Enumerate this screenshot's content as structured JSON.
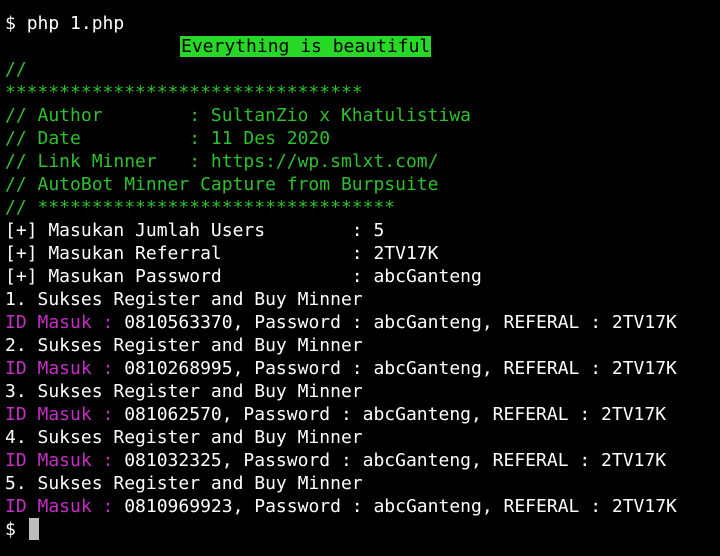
{
  "command_line": {
    "prompt": "$",
    "command": "php 1.php"
  },
  "banner": "Everything is beautiful",
  "header": {
    "comment": "//",
    "stars": "*********************************",
    "author": "// Author        : SultanZio x Khatulistiwa",
    "date": "// Date          : 11 Des 2020",
    "link": "// Link Minner   : https://wp.smlxt.com/",
    "desc": "// AutoBot Minner Capture from Burpsuite",
    "footer": "// *********************************"
  },
  "inputs": [
    {
      "text": "[+] Masukan Jumlah Users        : 5"
    },
    {
      "text": "[+] Masukan Referral            : 2TV17K"
    },
    {
      "text": "[+] Masukan Password            : abcGanteng"
    }
  ],
  "results": [
    {
      "status": "1. Sukses Register and Buy Minner",
      "label": "ID Masuk :",
      "detail": " 0810563370, Password : abcGanteng, REFERAL : 2TV17K"
    },
    {
      "status": "2. Sukses Register and Buy Minner",
      "label": "ID Masuk :",
      "detail": " 0810268995, Password : abcGanteng, REFERAL : 2TV17K"
    },
    {
      "status": "3. Sukses Register and Buy Minner",
      "label": "ID Masuk :",
      "detail": " 081062570, Password : abcGanteng, REFERAL : 2TV17K"
    },
    {
      "status": "4. Sukses Register and Buy Minner",
      "label": "ID Masuk :",
      "detail": " 081032325, Password : abcGanteng, REFERAL : 2TV17K"
    },
    {
      "status": "5. Sukses Register and Buy Minner",
      "label": "ID Masuk :",
      "detail": " 0810969923, Password : abcGanteng, REFERAL : 2TV17K"
    }
  ],
  "final_prompt": "$",
  "colors": {
    "background": "#000000",
    "text": "#ffffff",
    "green": "#2ec02e",
    "banner_bg": "#27d827",
    "magenta": "#c42fc4",
    "cursor": "#bdbdbd"
  }
}
